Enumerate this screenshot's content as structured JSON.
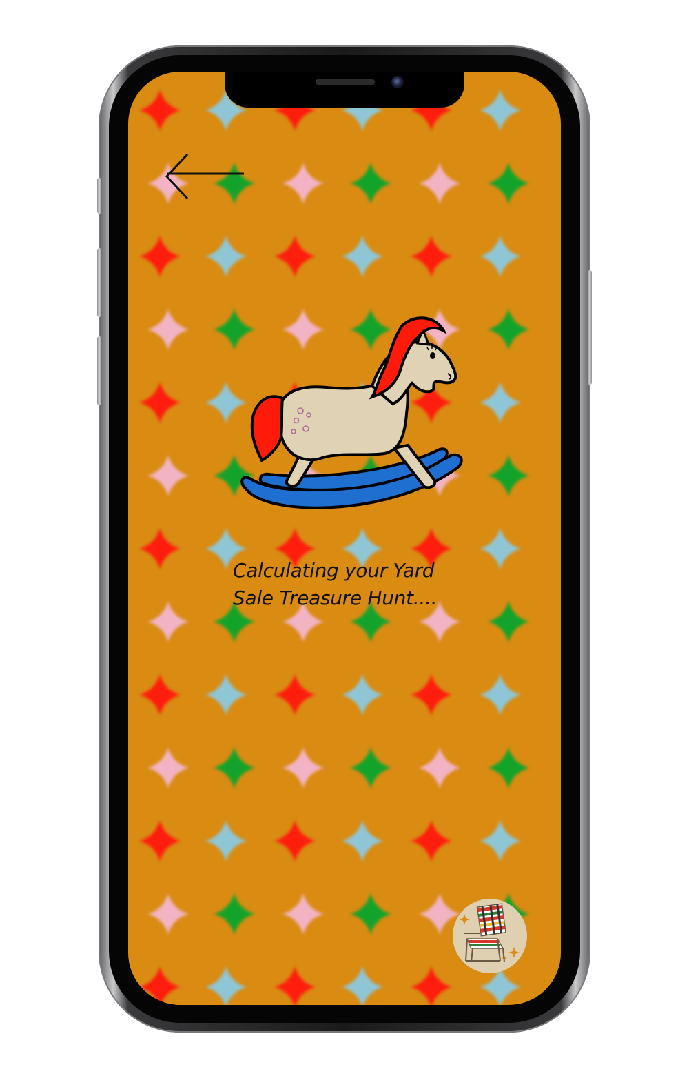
{
  "screen": {
    "background_color": "#d98b12",
    "sparkle_colors": [
      "#ff1e0e",
      "#8fc6d6",
      "#f2b4c4",
      "#14a32a"
    ]
  },
  "back_button": {
    "icon": "arrow-left-icon"
  },
  "illustration": {
    "icon": "rocking-horse-icon",
    "mane_color": "#ff1a0a",
    "body_color": "#e0d3b5",
    "rocker_color": "#1f6fd0"
  },
  "loading": {
    "line1": "Calculating your Yard",
    "line2": "Sale Treasure Hunt...."
  },
  "badge": {
    "icon": "lawn-chair-icon",
    "background_color": "#ded0b0"
  }
}
